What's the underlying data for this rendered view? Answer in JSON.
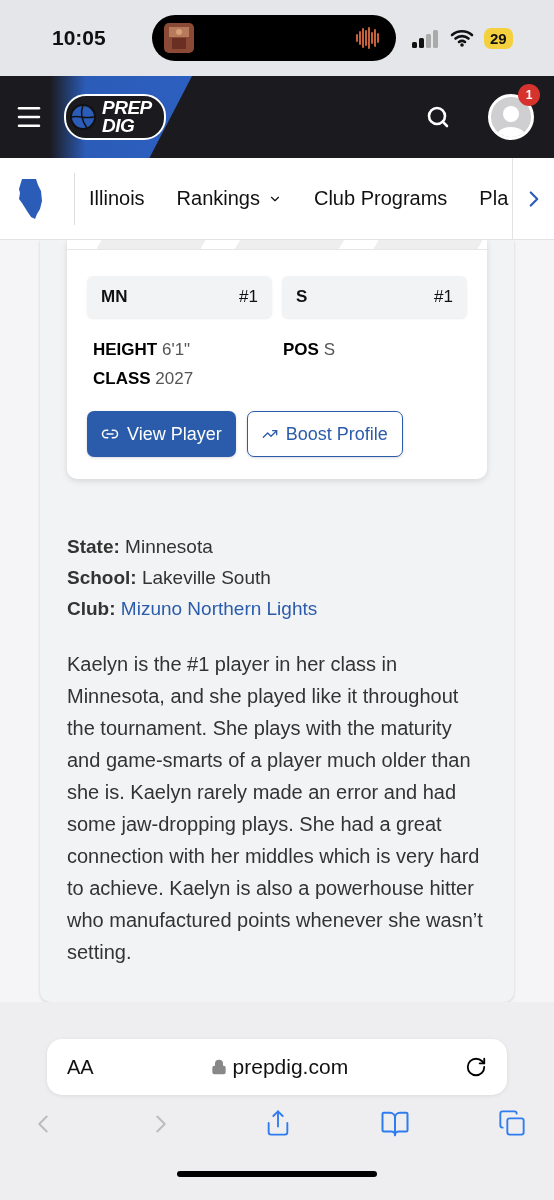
{
  "status_bar": {
    "time": "10:05",
    "battery": "29"
  },
  "header": {
    "logo": [
      "PREP",
      "DIG"
    ],
    "notifications": "1"
  },
  "nav": {
    "items": [
      {
        "label": "Illinois",
        "kind": "link"
      },
      {
        "label": "Rankings",
        "kind": "dropdown"
      },
      {
        "label": "Club Programs",
        "kind": "link"
      },
      {
        "label": "Pla",
        "kind": "link"
      }
    ]
  },
  "player_card": {
    "ranks": [
      {
        "label": "MN",
        "rank": "#1"
      },
      {
        "label": "S",
        "rank": "#1"
      }
    ],
    "attributes": [
      {
        "label": "HEIGHT",
        "value": "6'1\""
      },
      {
        "label": "POS",
        "value": "S"
      },
      {
        "label": "CLASS",
        "value": "2027"
      }
    ],
    "buttons": [
      {
        "label": "View Player",
        "kind": "primary"
      },
      {
        "label": "Boost Profile",
        "kind": "outline"
      }
    ]
  },
  "details": [
    {
      "label": "State:",
      "value": "Minnesota",
      "kind": "text"
    },
    {
      "label": "School:",
      "value": "Lakeville South",
      "kind": "text"
    },
    {
      "label": "Club:",
      "value": "Mizuno Northern Lights",
      "kind": "link"
    }
  ],
  "description": "Kaelyn is the #1 player in her class in Minnesota, and she played like it throughout the tournament. She plays with the maturity and game-smarts of a player much older than she is. Kaelyn rarely made an error and had some jaw-dropping plays. She had a great connection with her middles which is very hard to achieve. Kaelyn is also a powerhouse hitter who manufactured points whenever she wasn’t setting.",
  "browser": {
    "text_size": "AA",
    "url": "prepdig.com"
  }
}
